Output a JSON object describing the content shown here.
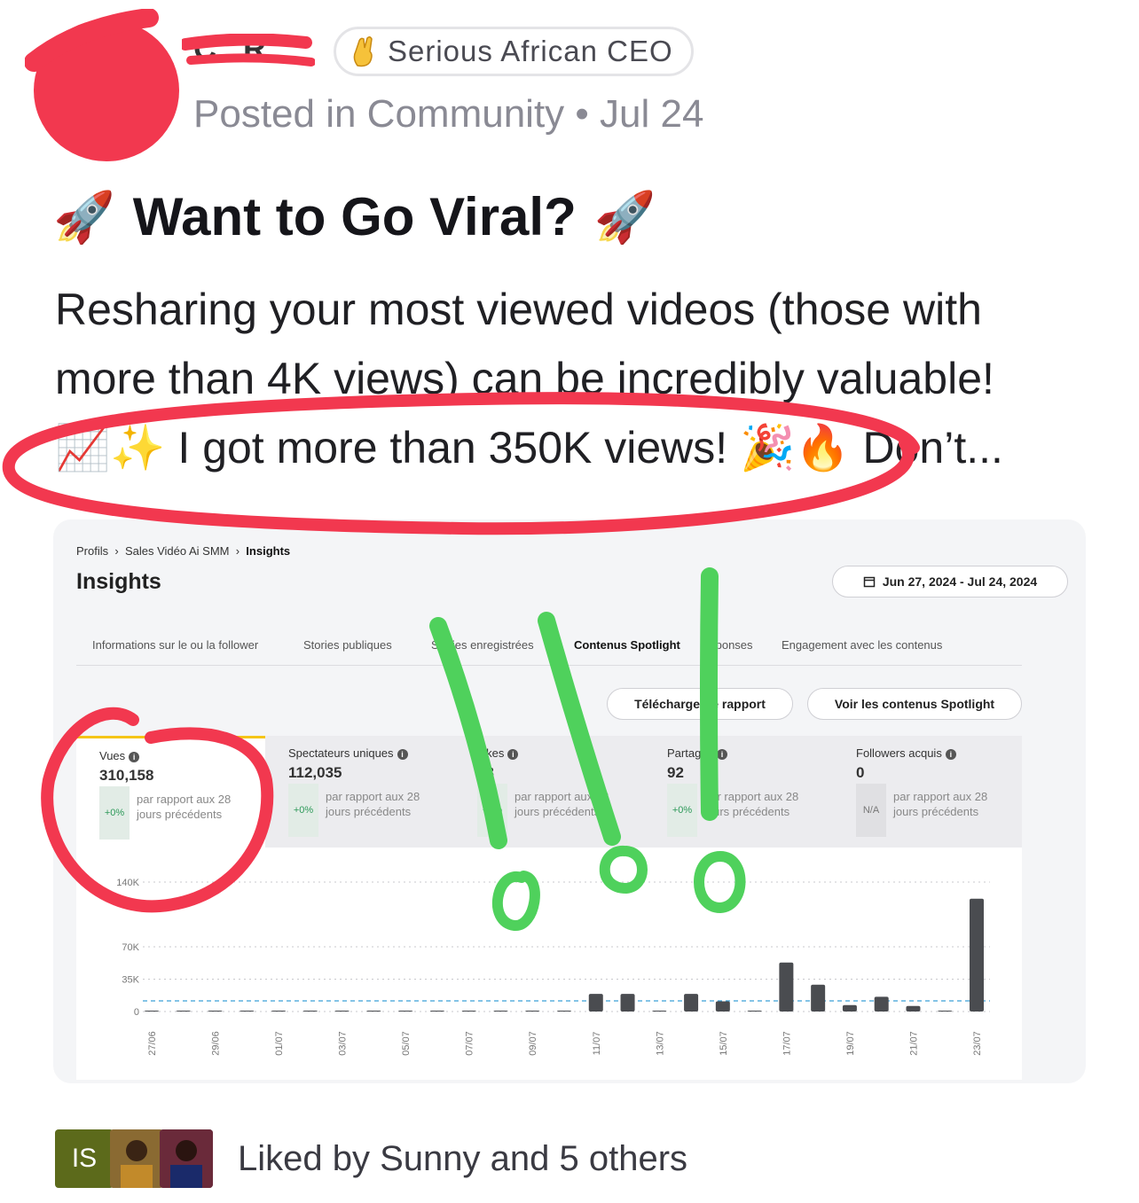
{
  "post": {
    "author_name": "C...R",
    "badge_icon": "crossed-fingers-emoji",
    "badge_text": "Serious African CEO",
    "meta": "Posted in Community • Jul 24",
    "title_emoji": "🚀",
    "title": "Want to Go Viral?",
    "body_line1": "Resharing your most viewed videos (those with",
    "body_line2": "more than 4K views) can be incredibly valuable!",
    "body_line3_prefix": "📈✨ ",
    "body_line3_main": "I got more than 350K views!",
    "body_line3_suffix": " 🎉🔥 Don’t..."
  },
  "screenshot": {
    "breadcrumb": [
      "Profils",
      "Sales Vidéo Ai SMM",
      "Insights"
    ],
    "page_title": "Insights",
    "date_range": "Jun 27, 2024 - Jul 24, 2024",
    "tabs": [
      "Informations sur le ou la follower",
      "Stories publiques",
      "Stories enregistrées",
      "Contenus Spotlight",
      "Réponses",
      "Engagement avec les contenus"
    ],
    "active_tab": "Contenus Spotlight",
    "download_button": "Télécharger le rapport",
    "view_button": "Voir les contenus Spotlight",
    "metrics": [
      {
        "label": "Vues",
        "value": "310,158",
        "delta": "+0%",
        "note": "par rapport aux 28 jours précédents"
      },
      {
        "label": "Spectateurs uniques",
        "value": "112,035",
        "delta": "+0%",
        "note": "par rapport aux 28 jours précédents"
      },
      {
        "label": "Likes",
        "value": "23",
        "delta": "+0%",
        "note": "par rapport aux 28 jours précédents"
      },
      {
        "label": "Partages",
        "value": "92",
        "delta": "+0%",
        "note": "par rapport aux 28 jours précédents"
      },
      {
        "label": "Followers acquis",
        "value": "0",
        "delta": "N/A",
        "note": "par rapport aux 28 jours précédents"
      }
    ]
  },
  "chart_data": {
    "type": "bar",
    "ylim": [
      0,
      140000
    ],
    "yticks": [
      "0",
      "35K",
      "70K",
      "140K"
    ],
    "ytick_values": [
      0,
      35000,
      70000,
      140000
    ],
    "categories": [
      "27/06",
      "28/06",
      "29/06",
      "30/06",
      "01/07",
      "02/07",
      "03/07",
      "04/07",
      "05/07",
      "06/07",
      "07/07",
      "08/07",
      "09/07",
      "10/07",
      "11/07",
      "12/07",
      "13/07",
      "14/07",
      "15/07",
      "16/07",
      "17/07",
      "18/07",
      "19/07",
      "20/07",
      "21/07",
      "22/07",
      "23/07"
    ],
    "xtick_labels": [
      "27/06",
      "29/06",
      "01/07",
      "03/07",
      "05/07",
      "07/07",
      "09/07",
      "11/07",
      "13/07",
      "15/07",
      "17/07",
      "19/07",
      "21/07",
      "23/07"
    ],
    "values": [
      0,
      0,
      0,
      0,
      0,
      0,
      0,
      0,
      0,
      0,
      0,
      0,
      0,
      0,
      19000,
      19000,
      1000,
      19000,
      11000,
      500,
      53000,
      29000,
      7000,
      16000,
      6000,
      1000,
      122000
    ],
    "reference_line": 11500,
    "bar_color": "#4a4c50"
  },
  "footer": {
    "avatar_initials": "IS",
    "liked_text": "Liked by Sunny and 5 others"
  },
  "colors": {
    "annotation_red": "#f2384f",
    "annotation_green": "#4fd15c"
  }
}
